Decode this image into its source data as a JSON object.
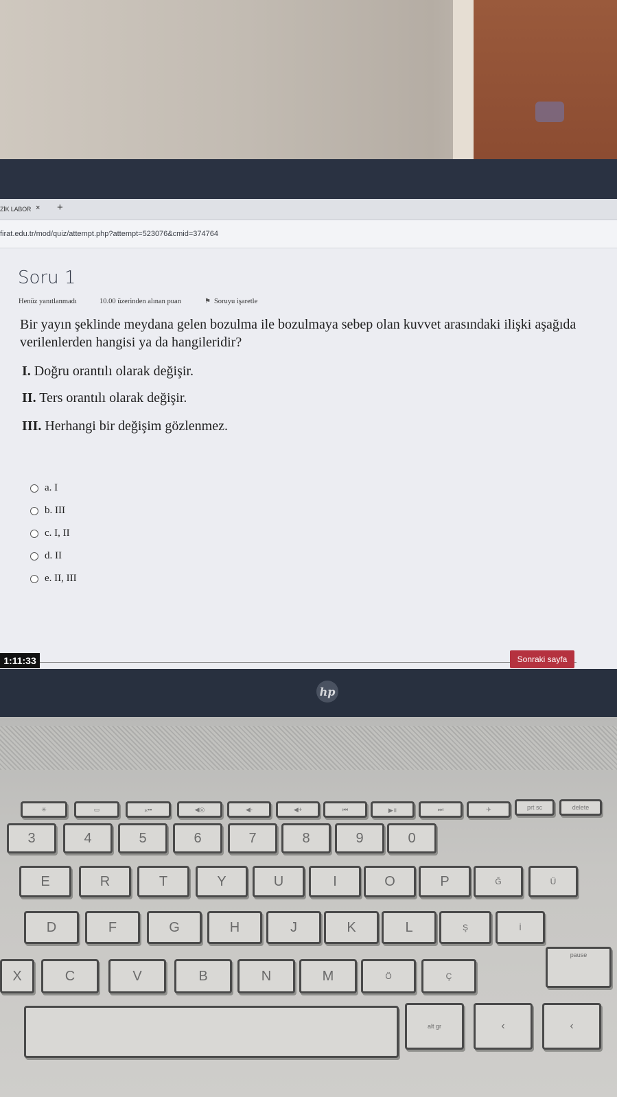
{
  "browser": {
    "tab_title": "ZİK LABOR",
    "tab_close": "×",
    "new_tab": "+",
    "url": "firat.edu.tr/mod/quiz/attempt.php?attempt=523076&cmid=374764"
  },
  "quiz": {
    "title": "Soru 1",
    "status": "Henüz yanıtlanmadı",
    "score": "10.00 üzerinden alınan puan",
    "flag_label": "Soruyu işaretle",
    "question": "Bir yayın şeklinde meydana gelen bozulma ile bozulmaya sebep olan kuvvet arasındaki ilişki aşağıda verilenlerden hangisi ya da hangileridir?",
    "statements": [
      {
        "num": "I.",
        "text": "Doğru orantılı olarak değişir."
      },
      {
        "num": "II.",
        "text": "Ters orantılı olarak değişir."
      },
      {
        "num": "III.",
        "text": "Herhangi bir değişim gözlenmez."
      }
    ],
    "options": [
      "a. I",
      "b. III",
      "c. I, II",
      "d. II",
      "e. II, III"
    ],
    "timer": "1:11:33",
    "next_button": "Sonraki sayfa"
  },
  "laptop": {
    "brand": "hp"
  },
  "keyboard": {
    "function_row": [
      "✳",
      "▭",
      "⁎▪▪",
      "◀◎",
      "◀-",
      "◀+",
      "⏮",
      "▶॥",
      "⏭",
      "✈",
      "prt sc",
      "delete"
    ],
    "number_row": [
      "3",
      "4",
      "5",
      "6",
      "7",
      "8",
      "9",
      "0"
    ],
    "top_row": [
      "E",
      "R",
      "T",
      "Y",
      "U",
      "I",
      "O",
      "P",
      "Ğ",
      "Ü"
    ],
    "home_row": [
      "D",
      "F",
      "G",
      "H",
      "J",
      "K",
      "L",
      "Ş",
      "İ"
    ],
    "bottom_row": [
      "X",
      "C",
      "V",
      "B",
      "N",
      "M",
      "Ö",
      "Ç"
    ],
    "alt_gr": "alt gr",
    "pause": "pause"
  }
}
